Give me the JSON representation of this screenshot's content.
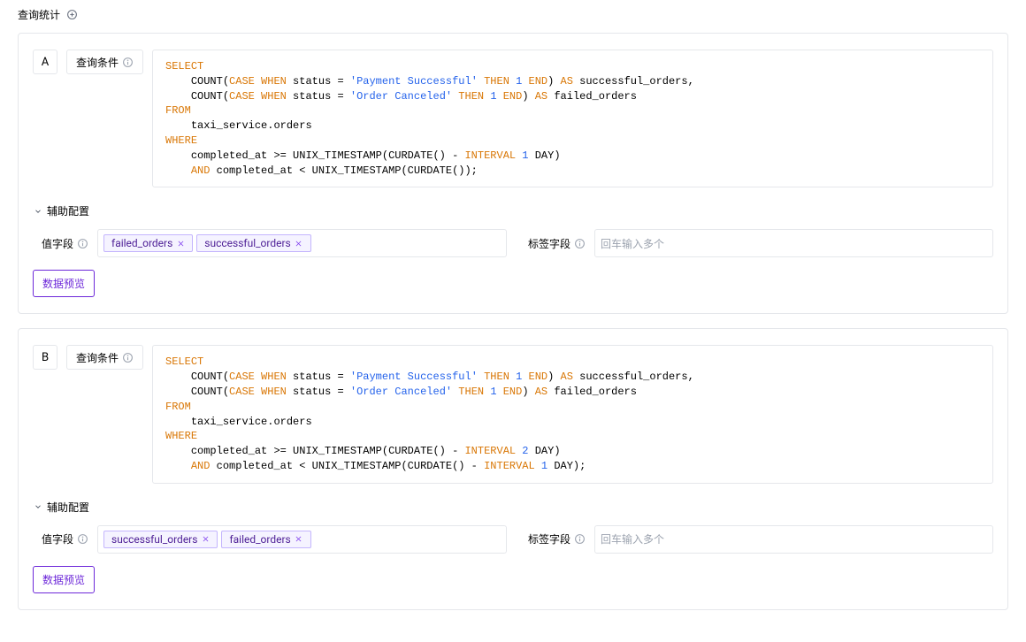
{
  "header": {
    "title": "查询统计"
  },
  "queries": [
    {
      "letter": "A",
      "cond_label": "查询条件",
      "sql_lines": [
        {
          "segs": [
            {
              "t": "SELECT",
              "c": "kw"
            }
          ]
        },
        {
          "indent": "    ",
          "segs": [
            {
              "t": "COUNT(",
              "c": ""
            },
            {
              "t": "CASE WHEN",
              "c": "kw"
            },
            {
              "t": " status = ",
              "c": ""
            },
            {
              "t": "'Payment Successful'",
              "c": "str"
            },
            {
              "t": " ",
              "c": ""
            },
            {
              "t": "THEN",
              "c": "kw"
            },
            {
              "t": " ",
              "c": ""
            },
            {
              "t": "1",
              "c": "num"
            },
            {
              "t": " ",
              "c": ""
            },
            {
              "t": "END",
              "c": "kw"
            },
            {
              "t": ") ",
              "c": ""
            },
            {
              "t": "AS",
              "c": "asw"
            },
            {
              "t": " successful_orders,",
              "c": ""
            }
          ]
        },
        {
          "indent": "    ",
          "segs": [
            {
              "t": "COUNT(",
              "c": ""
            },
            {
              "t": "CASE WHEN",
              "c": "kw"
            },
            {
              "t": " status = ",
              "c": ""
            },
            {
              "t": "'Order Canceled'",
              "c": "str"
            },
            {
              "t": " ",
              "c": ""
            },
            {
              "t": "THEN",
              "c": "kw"
            },
            {
              "t": " ",
              "c": ""
            },
            {
              "t": "1",
              "c": "num"
            },
            {
              "t": " ",
              "c": ""
            },
            {
              "t": "END",
              "c": "kw"
            },
            {
              "t": ") ",
              "c": ""
            },
            {
              "t": "AS",
              "c": "asw"
            },
            {
              "t": " failed_orders",
              "c": ""
            }
          ]
        },
        {
          "segs": [
            {
              "t": "FROM",
              "c": "kw"
            }
          ]
        },
        {
          "indent": "    ",
          "segs": [
            {
              "t": "taxi_service.orders",
              "c": ""
            }
          ]
        },
        {
          "segs": [
            {
              "t": "WHERE",
              "c": "kw"
            }
          ]
        },
        {
          "indent": "    ",
          "segs": [
            {
              "t": "completed_at >= UNIX_TIMESTAMP(CURDATE() - ",
              "c": ""
            },
            {
              "t": "INTERVAL",
              "c": "kw"
            },
            {
              "t": " ",
              "c": ""
            },
            {
              "t": "1",
              "c": "num"
            },
            {
              "t": " ",
              "c": ""
            },
            {
              "t": "DAY",
              "c": ""
            },
            {
              "t": ")",
              "c": ""
            }
          ]
        },
        {
          "indent": "    ",
          "segs": [
            {
              "t": "AND",
              "c": "kw"
            },
            {
              "t": " completed_at < UNIX_TIMESTAMP(CURDATE());",
              "c": ""
            }
          ]
        }
      ],
      "aux_label": "辅助配置",
      "value_field_label": "值字段",
      "tag_field_label": "标签字段",
      "tag_placeholder": "回车输入多个",
      "value_tags": [
        "failed_orders",
        "successful_orders"
      ],
      "label_tags": [],
      "preview_btn": "数据预览"
    },
    {
      "letter": "B",
      "cond_label": "查询条件",
      "sql_lines": [
        {
          "segs": [
            {
              "t": "SELECT",
              "c": "kw"
            }
          ]
        },
        {
          "indent": "    ",
          "segs": [
            {
              "t": "COUNT(",
              "c": ""
            },
            {
              "t": "CASE WHEN",
              "c": "kw"
            },
            {
              "t": " status = ",
              "c": ""
            },
            {
              "t": "'Payment Successful'",
              "c": "str"
            },
            {
              "t": " ",
              "c": ""
            },
            {
              "t": "THEN",
              "c": "kw"
            },
            {
              "t": " ",
              "c": ""
            },
            {
              "t": "1",
              "c": "num"
            },
            {
              "t": " ",
              "c": ""
            },
            {
              "t": "END",
              "c": "kw"
            },
            {
              "t": ") ",
              "c": ""
            },
            {
              "t": "AS",
              "c": "asw"
            },
            {
              "t": " successful_orders,",
              "c": ""
            }
          ]
        },
        {
          "indent": "    ",
          "segs": [
            {
              "t": "COUNT(",
              "c": ""
            },
            {
              "t": "CASE WHEN",
              "c": "kw"
            },
            {
              "t": " status = ",
              "c": ""
            },
            {
              "t": "'Order Canceled'",
              "c": "str"
            },
            {
              "t": " ",
              "c": ""
            },
            {
              "t": "THEN",
              "c": "kw"
            },
            {
              "t": " ",
              "c": ""
            },
            {
              "t": "1",
              "c": "num"
            },
            {
              "t": " ",
              "c": ""
            },
            {
              "t": "END",
              "c": "kw"
            },
            {
              "t": ") ",
              "c": ""
            },
            {
              "t": "AS",
              "c": "asw"
            },
            {
              "t": " failed_orders",
              "c": ""
            }
          ]
        },
        {
          "segs": [
            {
              "t": "FROM",
              "c": "kw"
            }
          ]
        },
        {
          "indent": "    ",
          "segs": [
            {
              "t": "taxi_service.orders",
              "c": ""
            }
          ]
        },
        {
          "segs": [
            {
              "t": "WHERE",
              "c": "kw"
            }
          ]
        },
        {
          "indent": "    ",
          "segs": [
            {
              "t": "completed_at >= UNIX_TIMESTAMP(CURDATE() - ",
              "c": ""
            },
            {
              "t": "INTERVAL",
              "c": "kw"
            },
            {
              "t": " ",
              "c": ""
            },
            {
              "t": "2",
              "c": "num"
            },
            {
              "t": " ",
              "c": ""
            },
            {
              "t": "DAY",
              "c": ""
            },
            {
              "t": ")",
              "c": ""
            }
          ]
        },
        {
          "indent": "    ",
          "segs": [
            {
              "t": "AND",
              "c": "kw"
            },
            {
              "t": " completed_at < UNIX_TIMESTAMP(CURDATE() - ",
              "c": ""
            },
            {
              "t": "INTERVAL",
              "c": "kw"
            },
            {
              "t": " ",
              "c": ""
            },
            {
              "t": "1",
              "c": "num"
            },
            {
              "t": " ",
              "c": ""
            },
            {
              "t": "DAY",
              "c": ""
            },
            {
              "t": ");",
              "c": ""
            }
          ]
        }
      ],
      "aux_label": "辅助配置",
      "value_field_label": "值字段",
      "tag_field_label": "标签字段",
      "tag_placeholder": "回车输入多个",
      "value_tags": [
        "successful_orders",
        "failed_orders"
      ],
      "label_tags": [],
      "preview_btn": "数据预览"
    }
  ]
}
